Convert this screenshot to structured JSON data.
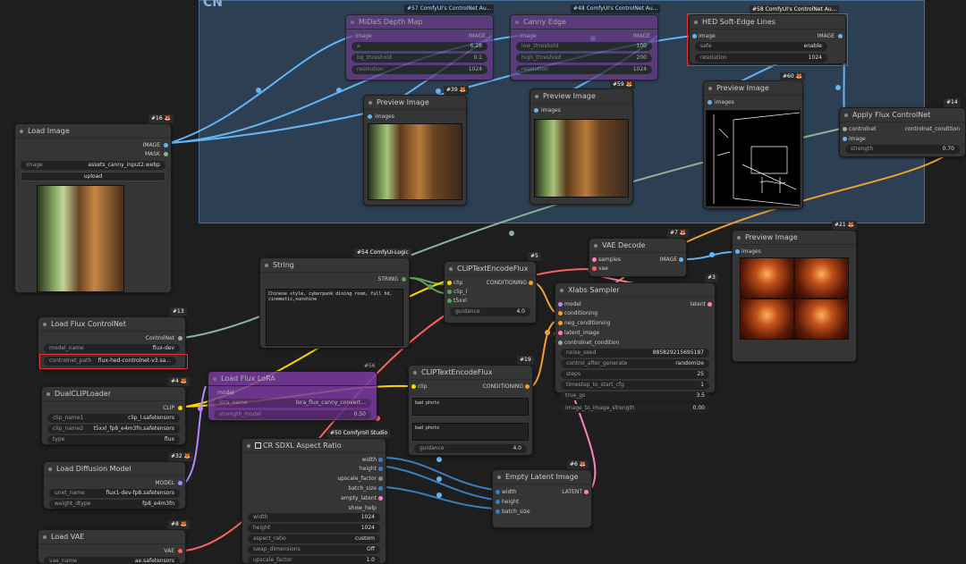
{
  "group": {
    "title": "CN"
  },
  "nodes": {
    "midas": {
      "badge": "#57 ComfyUI's ControlNet Au...",
      "title": "MiDaS Depth Map",
      "in_image": "image",
      "out_image": "IMAGE",
      "w1": {
        "name": "a",
        "value": "6.28"
      },
      "w2": {
        "name": "bg_threshold",
        "value": "0.1"
      },
      "w3": {
        "name": "resolution",
        "value": "1024"
      }
    },
    "canny": {
      "badge": "#48 ComfyUI's ControlNet Au...",
      "title": "Canny Edge",
      "in_image": "image",
      "out_image": "IMAGE",
      "w1": {
        "name": "low_threshold",
        "value": "100"
      },
      "w2": {
        "name": "high_threshold",
        "value": "200"
      },
      "w3": {
        "name": "resolution",
        "value": "1024"
      }
    },
    "hed": {
      "badge": "#58 ComfyUI's ControlNet Au...",
      "title": "HED Soft-Edge Lines",
      "in_image": "image",
      "out_image": "IMAGE",
      "w1": {
        "name": "safe",
        "value": "enable"
      },
      "w2": {
        "name": "resolution",
        "value": "1024"
      }
    },
    "prev39": {
      "badge": "#39 🦊",
      "title": "Preview Image",
      "in_images": "images"
    },
    "prev59": {
      "badge": "#59 🦊",
      "title": "Preview Image",
      "in_images": "images"
    },
    "prev60": {
      "badge": "#60 🦊",
      "title": "Preview Image",
      "in_images": "images"
    },
    "apply": {
      "badge": "#14",
      "title": "Apply Flux ControlNet",
      "in_cn": "controlnet",
      "in_image": "image",
      "out_cond": "controlnet_condition",
      "w1": {
        "name": "strength",
        "value": "0.70"
      }
    },
    "loadimg": {
      "badge": "#16 🦊",
      "title": "Load Image",
      "out_image": "IMAGE",
      "out_mask": "MASK",
      "w1": {
        "name": "image",
        "value": "assets_canny_input2.webp"
      },
      "upload": "upload"
    },
    "string": {
      "badge": "#54 ComfyUI-Logic",
      "title": "String",
      "out": "STRING",
      "text": "Chinese style, cyberpunk dining room, full hd, cinematic,sunshine"
    },
    "clip5": {
      "badge": "#5",
      "title": "CLIPTextEncodeFlux",
      "in_clip": "clip",
      "in_clipl": "clip_l",
      "in_t5": "t5xxl",
      "out": "CONDITIONING",
      "w1": {
        "name": "guidance",
        "value": "4.0"
      }
    },
    "vae": {
      "badge": "#7 🦊",
      "title": "VAE Decode",
      "in_samples": "samples",
      "in_vae": "vae",
      "out": "IMAGE"
    },
    "prev21": {
      "badge": "#21 🦊",
      "title": "Preview Image",
      "in_images": "images"
    },
    "xlabs": {
      "badge": "#3",
      "title": "Xlabs Sampler",
      "in_model": "model",
      "in_cond": "conditioning",
      "in_neg": "neg_conditioning",
      "in_latent": "latent_image",
      "in_cn": "controlnet_condition",
      "out": "latent",
      "w1": {
        "name": "noise_seed",
        "value": "885829215695187"
      },
      "w2": {
        "name": "control_after_generate",
        "value": "randomize"
      },
      "w3": {
        "name": "steps",
        "value": "25"
      },
      "w4": {
        "name": "timestep_to_start_cfg",
        "value": "1"
      },
      "w5": {
        "name": "true_gs",
        "value": "3.5"
      },
      "w6": {
        "name": "image_to_image_strength",
        "value": "0.00"
      }
    },
    "loadcn": {
      "badge": "#13",
      "title": "Load Flux ControlNet",
      "out": "ControlNet",
      "w1": {
        "name": "model_name",
        "value": "flux-dev"
      },
      "w2": {
        "name": "controlnet_path",
        "value": "flux-hed-controlnet-v3.sa..."
      }
    },
    "dual": {
      "badge": "#4 🦊",
      "title": "DualCLIPLoader",
      "out": "CLIP",
      "w1": {
        "name": "clip_name1",
        "value": "clip_l.safetensors"
      },
      "w2": {
        "name": "clip_name2",
        "value": "t5xxl_fp8_e4m3fn.safetensors"
      },
      "w3": {
        "name": "type",
        "value": "flux"
      }
    },
    "lora": {
      "badge": "#56",
      "title": "Load Flux LoRA",
      "in": "model",
      "w1": {
        "name": "lora_name",
        "value": "lora_flux_canny_convert..."
      },
      "w2": {
        "name": "strength_model",
        "value": "0.50"
      }
    },
    "clip19": {
      "badge": "#19",
      "title": "CLIPTextEncodeFlux",
      "in_clip": "clip",
      "out": "CONDITIONING",
      "t1": "bad photo",
      "t2": "bad photo",
      "w1": {
        "name": "guidance",
        "value": "4.0"
      }
    },
    "unet": {
      "badge": "#32 🦊",
      "title": "Load Diffusion Model",
      "out": "MODEL",
      "w1": {
        "name": "unet_name",
        "value": "flux1-dev-fp8.safetensors"
      },
      "w2": {
        "name": "weight_dtype",
        "value": "fp8_e4m3fn"
      }
    },
    "sdxl": {
      "badge": "#50 Comfyroll Studio",
      "title": "CR SDXL Aspect Ratio",
      "out_width": "width",
      "out_height": "height",
      "out_upscale": "upscale_factor",
      "out_batch": "batch_size",
      "out_empty": "empty_latent",
      "out_help": "show_help",
      "w1": {
        "name": "width",
        "value": "1024"
      },
      "w2": {
        "name": "height",
        "value": "1024"
      },
      "w3": {
        "name": "aspect_ratio",
        "value": "custom"
      },
      "w4": {
        "name": "swap_dimensions",
        "value": "Off"
      },
      "w5": {
        "name": "upscale_factor",
        "value": "1.0"
      }
    },
    "latent": {
      "badge": "#6 🦊",
      "title": "Empty Latent Image",
      "in_w": "width",
      "in_h": "height",
      "in_b": "batch_size",
      "out": "LATENT"
    },
    "loadvae": {
      "badge": "#8 🦊",
      "title": "Load VAE",
      "out": "VAE",
      "w1": {
        "name": "vae_name",
        "value": "ae.safetensors"
      }
    }
  }
}
